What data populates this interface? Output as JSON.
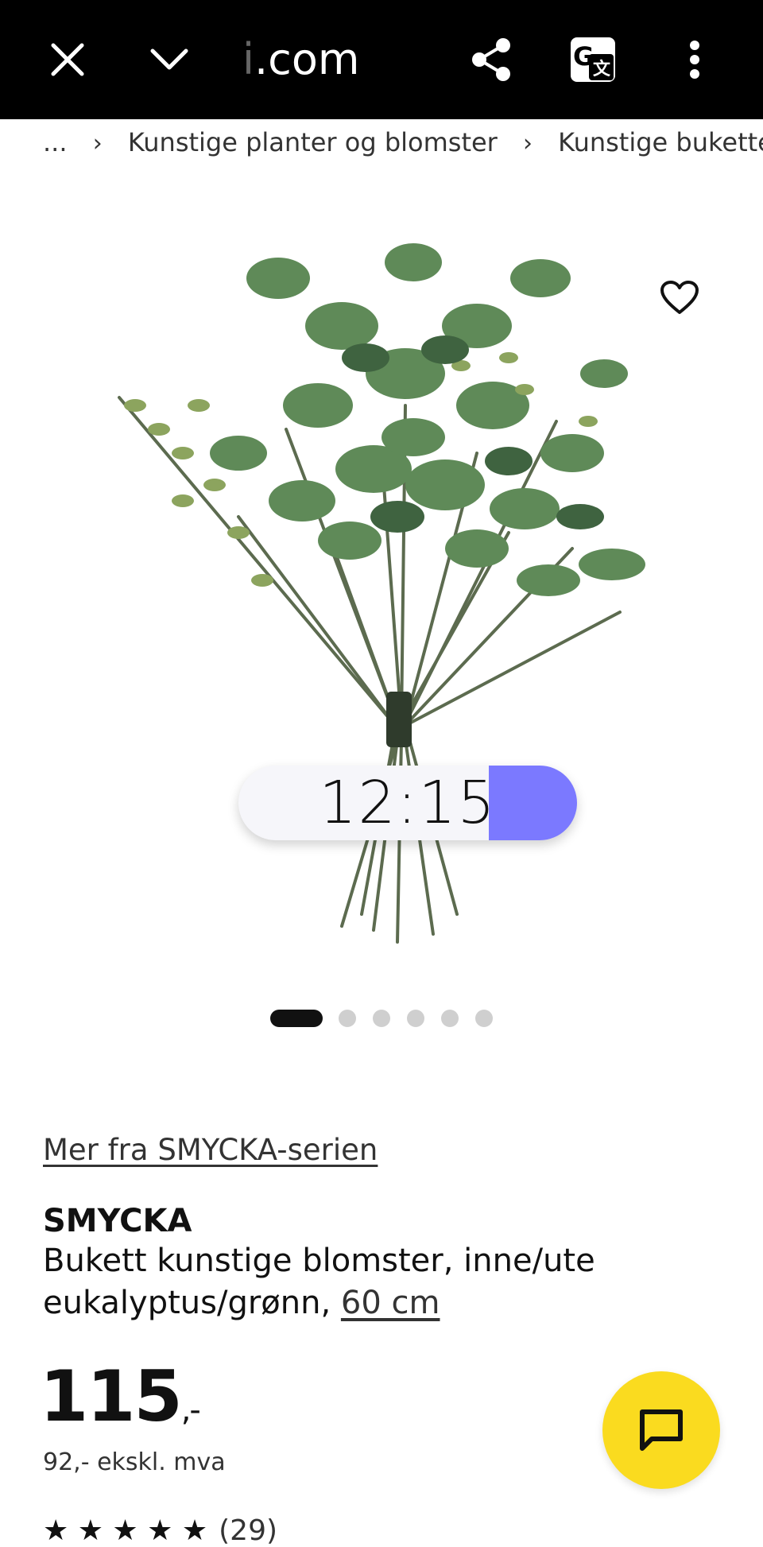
{
  "browser": {
    "url_faded": "i",
    "url_text": ".com"
  },
  "breadcrumb": {
    "ellipsis": "...",
    "items": [
      "Kunstige planter og blomster",
      "Kunstige buketter"
    ]
  },
  "carousel": {
    "total": 6,
    "active_index": 0
  },
  "clock": {
    "time": "12:15",
    "progress": 0.26,
    "accent": "#7b79ff"
  },
  "product": {
    "series_link": "Mer fra SMYCKA-serien",
    "name": "SMYCKA",
    "desc_line1": "Bukett kunstige blomster, inne/ute",
    "desc_line2": "eukalyptus/grønn, ",
    "size": "60 cm",
    "price": "115",
    "price_suffix": ",-",
    "price_ex_vat": "92,- ekskl. mva",
    "rating_stars": "★ ★ ★ ★ ★",
    "rating_count": "(29)"
  },
  "colors": {
    "topbar": "#000000",
    "fab": "#fadb1f"
  },
  "icons": [
    "close-icon",
    "chevron-down-icon",
    "share-icon",
    "translate-icon",
    "more-vert-icon",
    "heart-icon",
    "chat-icon"
  ]
}
